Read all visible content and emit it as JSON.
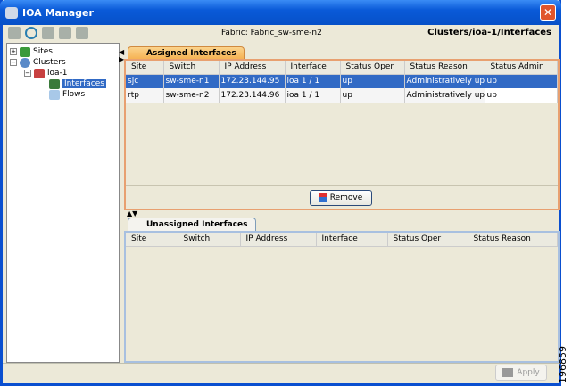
{
  "window": {
    "title": "IOA Manager",
    "close_label": "✕"
  },
  "header": {
    "fabric": "Fabric: Fabric_sw-sme-n2",
    "breadcrumb": "Clusters/ioa-1/Interfaces"
  },
  "tree": {
    "sites": "Sites",
    "clusters": "Clusters",
    "cluster": "ioa-1",
    "interfaces": "Interfaces",
    "flows": "Flows"
  },
  "assigned": {
    "tab": "Assigned Interfaces",
    "columns": [
      "Site",
      "Switch",
      "IP Address",
      "Interface",
      "Status Oper",
      "Status Reason",
      "Status Admin"
    ],
    "rows": [
      [
        "sjc",
        "sw-sme-n1",
        "172.23.144.95",
        "ioa 1 / 1",
        "up",
        "Administratively up",
        "up"
      ],
      [
        "rtp",
        "sw-sme-n2",
        "172.23.144.96",
        "ioa 1 / 1",
        "up",
        "Administratively up",
        "up"
      ]
    ],
    "remove_label": "Remove"
  },
  "unassigned": {
    "tab": "Unassigned Interfaces",
    "columns": [
      "Site",
      "Switch",
      "IP Address",
      "Interface",
      "Status Oper",
      "Status Reason"
    ]
  },
  "footer": {
    "apply_label": "Apply"
  },
  "figure_id": "196859"
}
